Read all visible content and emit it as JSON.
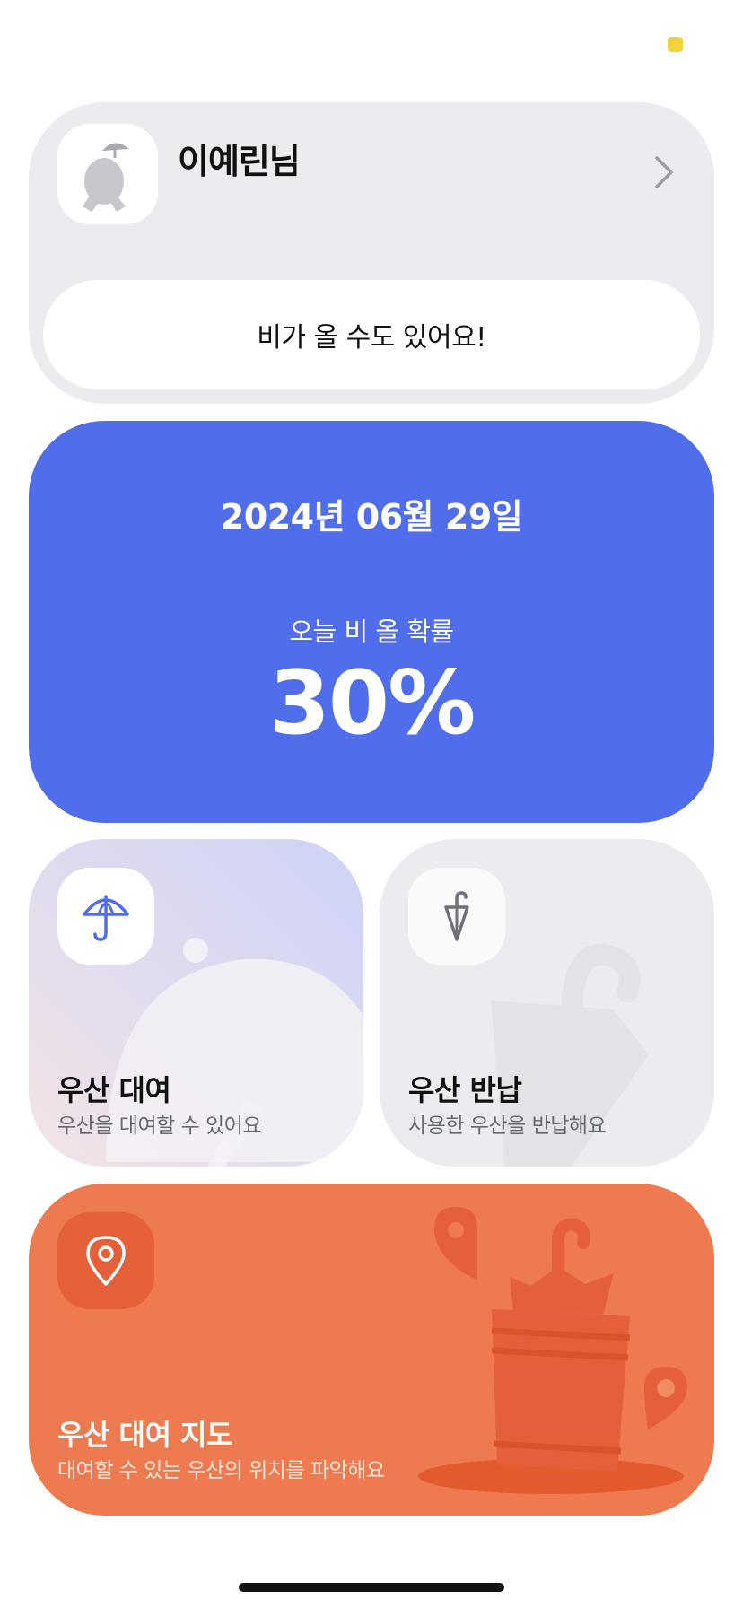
{
  "profile": {
    "name": "이예린님",
    "message": "비가 올 수도 있어요!"
  },
  "forecast": {
    "date": "2024년 06월 29일",
    "label": "오늘 비 올 확률",
    "probability": "30%"
  },
  "tiles": {
    "rent": {
      "title": "우산 대여",
      "subtitle": "우산을 대여할 수 있어요",
      "icon": "umbrella-icon"
    },
    "return": {
      "title": "우산 반납",
      "subtitle": "사용한 우산을 반납해요",
      "icon": "closed-umbrella-icon"
    },
    "map": {
      "title": "우산 대여 지도",
      "subtitle": "대여할 수 있는 우산의 위치를 파악해요",
      "icon": "location-pin-icon"
    }
  },
  "colors": {
    "accent_blue": "#506dec",
    "map_orange": "#ee7b50",
    "card_gray": "#ebecef",
    "status_yellow": "#f5d23c"
  }
}
